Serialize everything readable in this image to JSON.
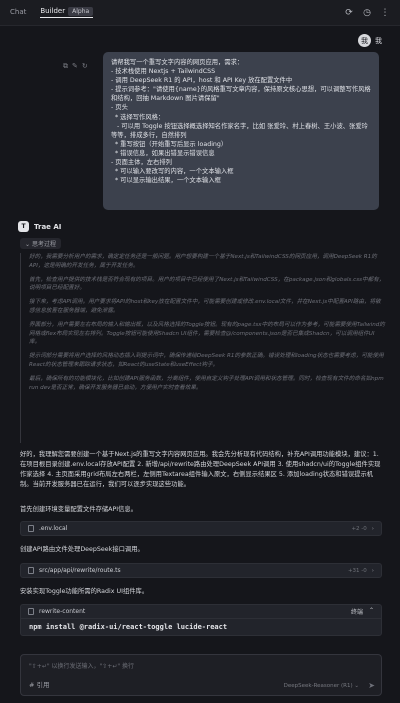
{
  "topbar": {
    "tabs": [
      "Chat",
      "Builder"
    ],
    "alpha_badge": "Alpha",
    "icons": [
      "cloud-sync-icon",
      "history-icon",
      "more-icon"
    ]
  },
  "user": {
    "avatar_letter": "我",
    "name": "我",
    "message": "请帮我写一个重写文字内容的网页应用，需求：\n- 技术栈使用 Nextjs + TailwindCSS\n- 调用 DeepSeek R1 的 API，host 和 API Key 放在配置文件中\n- 提示词参考：\"请使用{name}的风格重写文章内容，保持原文核心思想，可以调整写作风格和结构，回抽 Markdown 图片请保留\"\n- 页头\n  * 选择写作风格：\n   - 可以用 Toggle 按钮选择概选择知名作家名字，比如 张爱玲、村上春树、王小波、张爱玲等等，排成多行，自然排列\n  * 重写按钮（开始重写后显示 loading）\n  * 错误信息，如果出错显示错误信息\n- 页面主体，左右排列\n  * 可以输入要改写的内容，一个文本输入框\n  * 可以显示输出结果，一个文本输入框"
  },
  "ai": {
    "avatar_letter": "T",
    "name": "Trae AI",
    "thinking_label": "思考过程",
    "thinking_paragraphs": [
      "好的，我需要分析用户的需求，确定定任务还是一般问题。用户想要构建一个基于Next.js和TailwindCSS的网页应用，调用DeepSeek R1的API，这是明确的开发任务，属于开发任务。",
      "首先，检查用户提供的技术栈是否符合现有的项目。用户的项目中已经使用了Next.js和TailwindCSS，在package.json和globals.css中都有，说明项目已经配置好。",
      "接下来，考虑API调用。用户要求将API的host和key放在配置文件中，可能需要创建或修改.env.local文件，并在Next.js中配置API路由，将敏感信息放置在服务器端，避免泄露。",
      "界面部分，用户需要左右布局的输入和输出框，以及风格选择的Toggle按钮。现有的page.tsx中的布局可以作为参考，可能需要使用Tailwind的网格或flex布局实现左右排列。Toggle按钮可能使用Shadcn UI组件，需要检查@/components.json是否已集成Shadcn，可以调用组件UI库。",
      "提示词部分需要将用户选择的风格动态插入到提示词中，确保传递给DeepSeek R1的参数正确。错误处理和loading状态也需要考虑，可能使用React的状态管理来跟踪请求状态，如React的useState和useEffect钩子。",
      "最后，确保所有的功能模块化，比如创建API服务函数，分离组件，使用自定义钩子处理API调用和状态管理。同时，检查现有文件的命名如npm run dev是否正常，确保开发服务器已启动，方便用户实时查看效果。"
    ],
    "intro": "好的，我理解您需要创建一个基于Next.js的重写文字内容网页应用。我会先分析现有代码结构，补充API调用功能模块，建议：1. 在项目根目录创建.env.local存放API配置 2. 新增/api/rewrite路由处理DeepSeek API调用 3. 使用shadcn/ui的Toggle组件实现作家选择 4. 主页面采用grid布局左右两栏，左侧用Textarea组件输入原文，右侧显示结果区 5. 添加loading状态和错误提示机制。当前开发服务器已在运行，我们可以逐步实现这些功能。",
    "step1_text": "首先创建环境变量配置文件存储API信息。",
    "file1": {
      "name": ".env.local",
      "diff": "+2 -0"
    },
    "step2_text": "创建API路由文件处理DeepSeek接口调用。",
    "file2": {
      "name": "src/app/api/rewrite/route.ts",
      "diff": "+31 -0"
    },
    "step3_text": "安装实现Toggle功能所需的Radix UI组件库。",
    "terminal": {
      "label": "rewrite-content",
      "open_label": "终端",
      "command": "npm install @radix-ui/react-toggle lucide-react"
    }
  },
  "input": {
    "placeholder": "\"⇧+↵\" 以换行发送输入，\"⇧+↵\" 换行",
    "mention": "# 引用",
    "model": "DeepSeek-Reasoner (R1)"
  }
}
